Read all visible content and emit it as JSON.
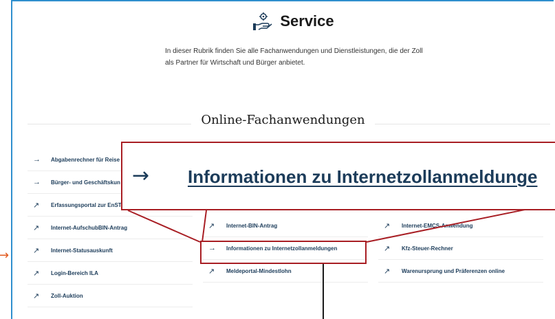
{
  "header": {
    "title": "Service",
    "intro": "In dieser Rubrik finden Sie alle Fachanwendungen und Dienstleistungen, die der Zoll als Partner für Wirtschaft und Bürger anbietet."
  },
  "section": {
    "title": "Online-Fachanwendungen"
  },
  "columns": [
    {
      "items": [
        {
          "arrow": "→",
          "label": "Abgabenrechner für Reise"
        },
        {
          "arrow": "→",
          "label": "Bürger- und Geschäftskun"
        },
        {
          "arrow": "↗",
          "label": "Erfassungsportal zur EnST"
        },
        {
          "arrow": "↗",
          "label": "Internet-AufschubBIN-Antrag"
        },
        {
          "arrow": "↗",
          "label": "Internet-Statusauskunft"
        },
        {
          "arrow": "↗",
          "label": "Login-Bereich ILA"
        },
        {
          "arrow": "↗",
          "label": "Zoll-Auktion"
        }
      ]
    },
    {
      "items": [
        {
          "arrow": "↗",
          "label": "Internet-BIN-Antrag"
        },
        {
          "arrow": "→",
          "label": "Informationen zu Internetzollanmeldungen"
        },
        {
          "arrow": "↗",
          "label": "Meldeportal-Mindestlohn"
        }
      ]
    },
    {
      "items": [
        {
          "arrow": "↗",
          "label": "Internet-EMCS-Anwendung"
        },
        {
          "arrow": "↗",
          "label": "Kfz-Steuer-Rechner"
        },
        {
          "arrow": "↗",
          "label": "Warenursprung und Präferenzen online"
        }
      ]
    }
  ],
  "zoom": {
    "arrow": "→",
    "label": "Informationen zu Internetzollanmeldunge"
  },
  "pointer": {
    "arrow": "→"
  },
  "colors": {
    "accent_red": "#a81e24",
    "link_navy": "#1c3c5a",
    "frame_blue": "#2f8fce"
  }
}
